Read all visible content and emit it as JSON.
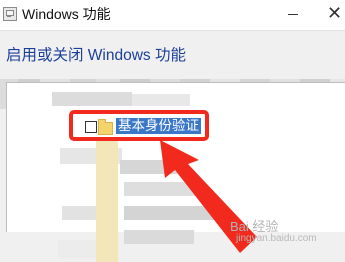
{
  "window": {
    "title": "Windows 功能",
    "close_glyph": "✕"
  },
  "dialog": {
    "heading": "启用或关闭 Windows 功能"
  },
  "feature_tree": {
    "highlighted_item": {
      "label": "基本身份验证",
      "checked": false
    }
  },
  "annotation": {
    "color": "#f22a1d"
  },
  "watermark": {
    "text": "Bai 经验",
    "url": "jingyan.baidu.com"
  },
  "colors": {
    "heading": "#1c3f9a",
    "selection": "#3a77c8",
    "folder": "#f3d36b"
  },
  "icons": [
    "window-app-icon",
    "minimize-icon",
    "close-icon",
    "folder-icon",
    "checkbox-unchecked"
  ]
}
